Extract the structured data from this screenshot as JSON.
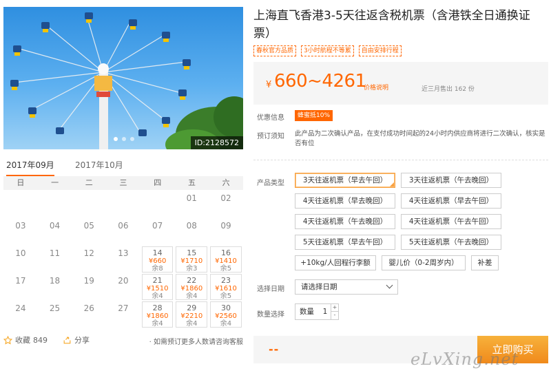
{
  "product": {
    "title": "上海直飞香港3-5天往返含税机票（含港铁全日通换证票）",
    "tags": [
      "春秋官方品质",
      "3小时航程不等累",
      "自由安排行程"
    ],
    "price_yen": "¥",
    "price_range": "660~4261",
    "price_note": "价格说明",
    "sold_text": "近三月售出 162 份",
    "photo_id": "ID:2128572"
  },
  "labels": {
    "promo": "优惠信息",
    "booking_notice": "预订须知",
    "product_type": "产品类型",
    "select_date": "选择日期",
    "select_qty": "数量选择"
  },
  "promo_badge": "蜂蜜抵10%",
  "notice_text": "此产品为二次确认产品，在支付成功时间起的24小时内供应商将进行二次确认，核实是否有位",
  "options": [
    "3天往返机票（早去午回）",
    "3天往返机票（午去晚回）",
    "4天往返机票（早去晚回）",
    "4天往返机票（早去午回）",
    "4天往返机票（午去晚回）",
    "4天往返机票（午去午回）",
    "5天往返机票（早去午回）",
    "5天往返机票（午去晚回）",
    "+10kg/人回程行李额",
    "婴儿价（0-2周岁内）",
    "补差"
  ],
  "selected_option": 0,
  "date_select_placeholder": "请选择日期",
  "quantity": {
    "label": "数量",
    "value": "1",
    "up": "+",
    "down": "-"
  },
  "total_text": "--",
  "buy_button": "立即购买",
  "calendar": {
    "tabs": [
      "2017年09月",
      "2017年10月"
    ],
    "active_tab": 0,
    "weekdays": [
      "日",
      "一",
      "二",
      "三",
      "四",
      "五",
      "六"
    ],
    "rows": [
      [
        {
          "d": ""
        },
        {
          "d": ""
        },
        {
          "d": ""
        },
        {
          "d": ""
        },
        {
          "d": ""
        },
        {
          "d": "01"
        },
        {
          "d": "02"
        }
      ],
      [
        {
          "d": "03"
        },
        {
          "d": "04"
        },
        {
          "d": "05"
        },
        {
          "d": "06"
        },
        {
          "d": "07"
        },
        {
          "d": "08"
        },
        {
          "d": "09"
        }
      ],
      [
        {
          "d": "10"
        },
        {
          "d": "11"
        },
        {
          "d": "12"
        },
        {
          "d": "13"
        },
        {
          "d": "14",
          "p": "¥660",
          "s": "余8"
        },
        {
          "d": "15",
          "p": "¥1710",
          "s": "余3"
        },
        {
          "d": "16",
          "p": "¥1410",
          "s": "余5"
        }
      ],
      [
        {
          "d": "17"
        },
        {
          "d": "18"
        },
        {
          "d": "19"
        },
        {
          "d": "20"
        },
        {
          "d": "21",
          "p": "¥1510",
          "s": "余4"
        },
        {
          "d": "22",
          "p": "¥1860",
          "s": "余4"
        },
        {
          "d": "23",
          "p": "¥1610",
          "s": "余5"
        }
      ],
      [
        {
          "d": "24"
        },
        {
          "d": "25"
        },
        {
          "d": "26"
        },
        {
          "d": "27"
        },
        {
          "d": "28",
          "p": "¥1860",
          "s": "余4"
        },
        {
          "d": "29",
          "p": "¥2210",
          "s": "余4"
        },
        {
          "d": "30",
          "p": "¥2560",
          "s": "余4"
        }
      ]
    ]
  },
  "social": {
    "fav_label": "收藏",
    "fav_count": "849",
    "share_label": "分享",
    "consult_text": "· 如需预订更多人数请咨询客服"
  },
  "watermark": "eLvXing.net",
  "colors": {
    "accent": "#ff6600",
    "buy_button": "#f39a24"
  }
}
